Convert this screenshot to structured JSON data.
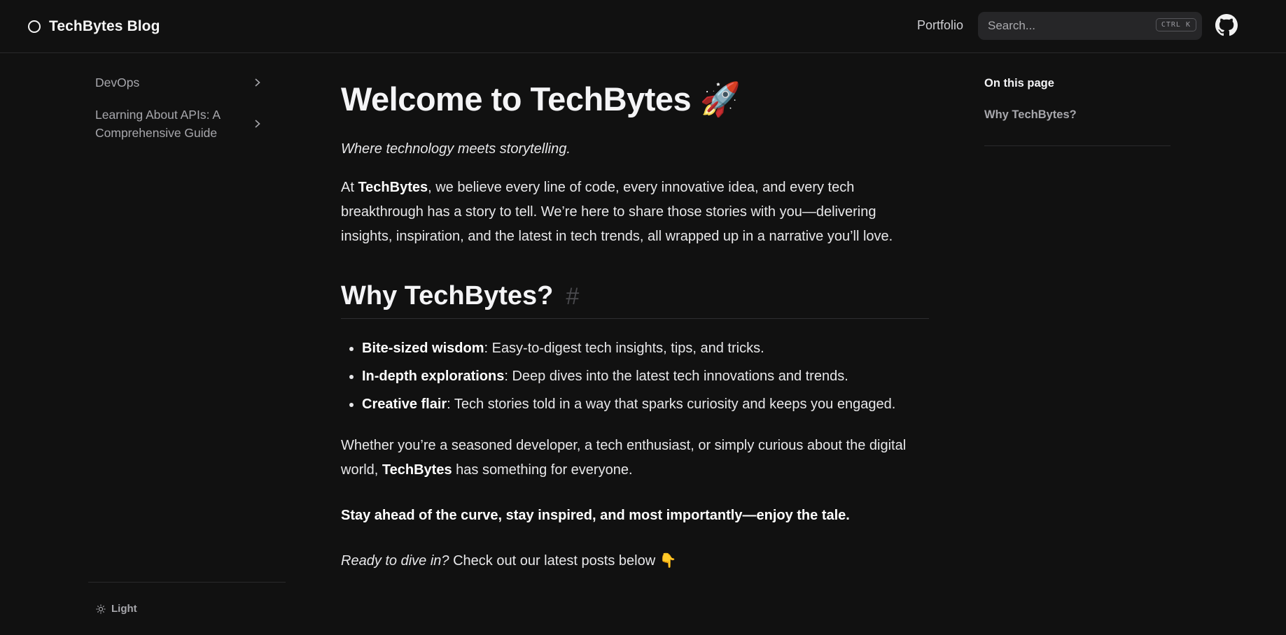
{
  "header": {
    "logo_text": "TechBytes Blog",
    "nav_portfolio": "Portfolio",
    "search_placeholder": "Search...",
    "search_shortcut": "CTRL K",
    "github_icon": "github-icon"
  },
  "sidebar": {
    "items": [
      {
        "label": "DevOps"
      },
      {
        "label": "Learning About APIs: A Comprehensive Guide"
      }
    ],
    "theme_toggle_label": "Light"
  },
  "main": {
    "title": "Welcome to TechBytes",
    "title_emoji": "🚀",
    "tagline": "Where technology meets storytelling.",
    "intro_prefix": "At ",
    "intro_brand": "TechBytes",
    "intro_rest": ", we believe every line of code, every innovative idea, and every tech breakthrough has a story to tell. We’re here to share those stories with you—delivering insights, inspiration, and the latest in tech trends, all wrapped up in a narrative you’ll love.",
    "section_heading": "Why TechBytes?",
    "section_anchor": "#",
    "features": [
      {
        "title": "Bite-sized wisdom",
        "text": ": Easy-to-digest tech insights, tips, and tricks."
      },
      {
        "title": "In-depth explorations",
        "text": ": Deep dives into the latest tech innovations and trends."
      },
      {
        "title": "Creative flair",
        "text": ": Tech stories told in a way that sparks curiosity and keeps you engaged."
      }
    ],
    "audience_prefix": "Whether you’re a seasoned developer, a tech enthusiast, or simply curious about the digital world, ",
    "audience_brand": "TechBytes",
    "audience_suffix": " has something for everyone.",
    "closing_bold": "Stay ahead of the curve, stay inspired, and most importantly—enjoy the tale.",
    "cta_italic": "Ready to dive in?",
    "cta_rest": " Check out our latest posts below",
    "cta_emoji": "👇"
  },
  "toc": {
    "title": "On this page",
    "links": [
      "Why TechBytes?"
    ]
  }
}
